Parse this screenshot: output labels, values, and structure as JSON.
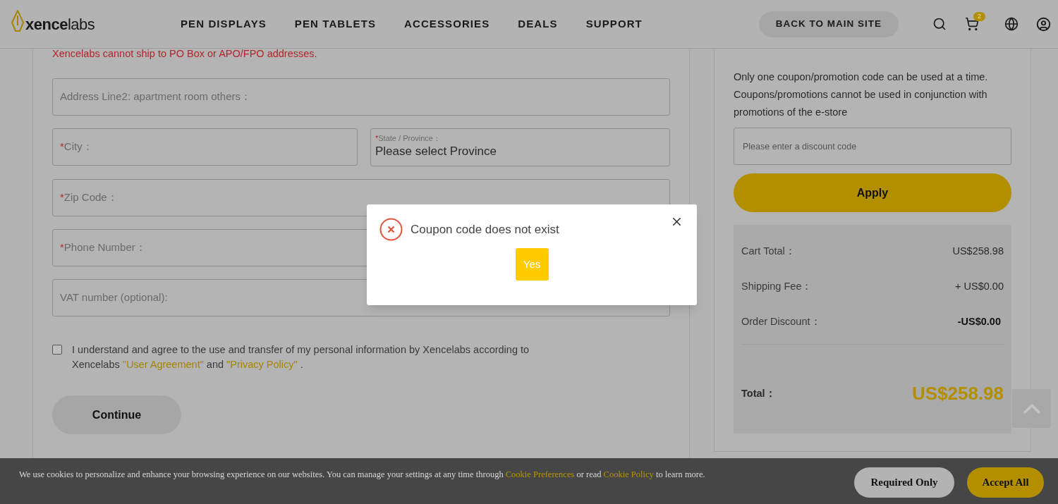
{
  "header": {
    "logo_bold": "xence",
    "logo_light": "labs",
    "nav": [
      "PEN DISPLAYS",
      "PEN TABLETS",
      "ACCESSORIES",
      "DEALS",
      "SUPPORT"
    ],
    "back_button": "BACK TO MAIN SITE",
    "cart_count": "2"
  },
  "shipping_form": {
    "required_mark": "*",
    "notice": "Xencelabs cannot ship to PO Box or APO/FPO addresses.",
    "rows": [
      [
        {
          "kind": "text",
          "label": "Address Line2: apartment room others：",
          "required": false
        }
      ],
      [
        {
          "kind": "text",
          "label": "City：",
          "required": true
        },
        {
          "kind": "select",
          "label": "State / Province：",
          "value": "Please select Province",
          "required": true
        }
      ],
      [
        {
          "kind": "text",
          "label": "Zip Code：",
          "required": true
        }
      ],
      [
        {
          "kind": "text",
          "label": "Phone Number：",
          "required": true
        }
      ],
      [
        {
          "kind": "text",
          "label": "VAT number (optional):",
          "required": false
        }
      ]
    ],
    "consent": {
      "checked": false,
      "text": "I understand and agree to the use and transfer of my personal information by Xencelabs according to Xencelabs",
      "link_1": "\"User Agreement\"",
      "joiner": "and",
      "link_2": "\"Privacy Policy\"",
      "end": "."
    },
    "continue_button": "Continue"
  },
  "coupon": {
    "note": "Only one coupon/promotion code can be used at a time. Coupons/promotions cannot be used in conjunction with promotions of the e-store",
    "placeholder": "Please enter a discount code",
    "apply_button": "Apply"
  },
  "summary": {
    "rows": [
      {
        "label": "Cart Total：",
        "value": "US$258.98",
        "kind": "normal"
      },
      {
        "label": "Shipping Fee：",
        "value": "+ US$0.00",
        "kind": "normal"
      },
      {
        "label": "Order Discount：",
        "value": "-US$0.00",
        "kind": "bold"
      }
    ],
    "total_label": "Total：",
    "total_value": "US$258.98"
  },
  "dialog": {
    "message": "Coupon code does not exist",
    "button": "Yes"
  },
  "cookie_banner": {
    "text": "We use cookies to personalize and enhance your browsing experience on our websites. You can manage your settings at any time through",
    "link_1": "Cookie Preferences",
    "middle": "or read",
    "link_2": "Cookie Policy",
    "end": "to learn more.",
    "buttons": [
      {
        "label": "Required Only",
        "kind": "secondary"
      },
      {
        "label": "Accept All",
        "kind": "primary"
      }
    ]
  }
}
